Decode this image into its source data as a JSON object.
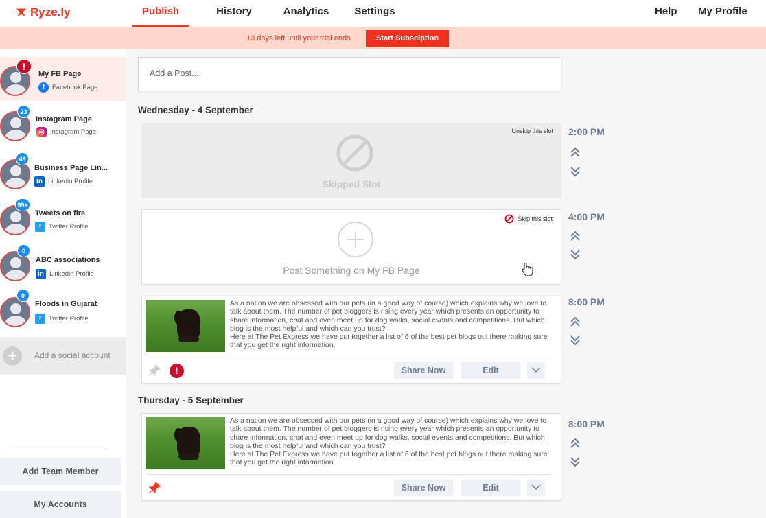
{
  "brand": {
    "name": "Ryze.ly",
    "color": "#f0321e"
  },
  "nav": {
    "tabs": [
      {
        "label": "Publish",
        "active": true
      },
      {
        "label": "History",
        "active": false
      },
      {
        "label": "Analytics",
        "active": false
      },
      {
        "label": "Settings",
        "active": false
      }
    ],
    "help": "Help",
    "profile": "My Profile"
  },
  "trial": {
    "text": "13 days left until your trial ends",
    "button": "Start Subsciption"
  },
  "sidebar": {
    "accounts": [
      {
        "name": "My FB Page",
        "type": "Facebook Page",
        "network": "facebook",
        "badge": "!",
        "active": true
      },
      {
        "name": "Instagram Page",
        "type": "Instagram Page",
        "network": "instagram",
        "badge": "23"
      },
      {
        "name": "Business Page Lin...",
        "type": "Linkedin Profile",
        "network": "linkedin",
        "badge": "48"
      },
      {
        "name": "Tweets on fire",
        "type": "Twitter Profile",
        "network": "twitter",
        "badge": "99+"
      },
      {
        "name": "ABC associations",
        "type": "Linkedin Profile",
        "network": "linkedin",
        "badge": "0"
      },
      {
        "name": "Floods in Gujarat",
        "type": "Twitter Profile",
        "network": "twitter",
        "badge": "0"
      }
    ],
    "add_account": "Add a social account",
    "add_team_member": "Add Team Member",
    "my_accounts": "My Accounts"
  },
  "main": {
    "add_post_placeholder": "Add a Post...",
    "days": [
      {
        "title": "Wednesday - 4 September",
        "slots": [
          {
            "kind": "skipped",
            "time": "2:00 PM",
            "action": "Unskip this slot",
            "label": "Skipped Slot"
          },
          {
            "kind": "empty",
            "time": "4:00 PM",
            "action": "Skip this slot",
            "label": "Post Something on My FB Page"
          },
          {
            "kind": "post",
            "time": "8:00 PM",
            "text": "As a nation we are obsessed with our pets (in a good way of course) which explains why we love to talk about them. The number of pet bloggers is rising every year which presents an opportunity to share information, chat and even meet up for dog walks, social events and competitions. But which blog is the most helpful and which can you trust?\nHere at The Pet Express we have put together a list of 6 of the best pet blogs out there making sure that you get the right information.",
            "share": "Share Now",
            "edit": "Edit",
            "pinned": false,
            "error": "!"
          }
        ]
      },
      {
        "title": "Thursday - 5 September",
        "slots": [
          {
            "kind": "post",
            "time": "8:00 PM",
            "text": "As a nation we are obsessed with our pets (in a good way of course) which explains why we love to talk about them. The number of pet bloggers is rising every year which presents an opportunity to share information, chat and even meet up for dog walks, social events and competitions. But which blog is the most helpful and which can you trust?\nHere at The Pet Express we have put together a list of 6 of the best pet blogs out there making sure that you get the right information.",
            "share": "Share Now",
            "edit": "Edit",
            "pinned": true
          }
        ]
      }
    ]
  }
}
